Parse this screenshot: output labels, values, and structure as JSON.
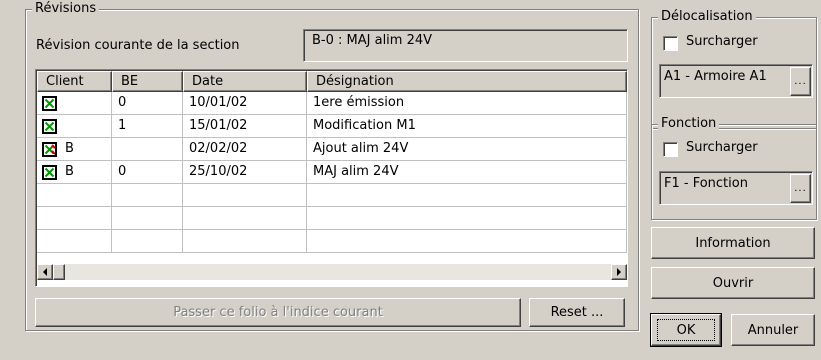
{
  "revisions": {
    "title": "Révisions",
    "current_label": "Révision courante de la section",
    "current_value": "B-0 : MAJ alim 24V",
    "columns": [
      "Client",
      "BE",
      "Date",
      "Désignation"
    ],
    "rows": [
      {
        "client_check": "checked",
        "client": "",
        "be": "0",
        "date": "10/01/02",
        "designation": "1ere émission"
      },
      {
        "client_check": "checked",
        "client": "",
        "be": "1",
        "date": "15/01/02",
        "designation": "Modification M1"
      },
      {
        "client_check": "checked-red",
        "client": "B",
        "be": "",
        "date": "02/02/02",
        "designation": "Ajout alim 24V"
      },
      {
        "client_check": "checked",
        "client": "B",
        "be": "0",
        "date": "25/10/02",
        "designation": "MAJ alim 24V"
      }
    ],
    "pass_button": "Passer ce folio à l'indice courant",
    "reset_button": "Reset ..."
  },
  "delocalisation": {
    "title": "Délocalisation",
    "override_label": "Surcharger",
    "override_checked": false,
    "value": "A1 - Armoire A1",
    "browse_label": "..."
  },
  "fonction": {
    "title": "Fonction",
    "override_label": "Surcharger",
    "override_checked": false,
    "value": "F1 - Fonction",
    "browse_label": "..."
  },
  "buttons": {
    "information": "Information",
    "ouvrir": "Ouvrir",
    "ok": "OK",
    "annuler": "Annuler"
  },
  "scroll_icons": {
    "left": "arrow-left-icon",
    "right": "arrow-right-icon"
  }
}
